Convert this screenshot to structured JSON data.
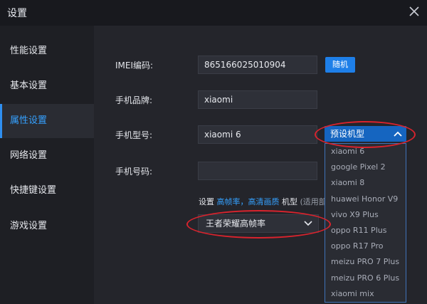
{
  "window": {
    "title": "设置"
  },
  "sidebar": {
    "items": [
      {
        "label": "性能设置"
      },
      {
        "label": "基本设置"
      },
      {
        "label": "属性设置"
      },
      {
        "label": "网络设置"
      },
      {
        "label": "快捷键设置"
      },
      {
        "label": "游戏设置"
      }
    ],
    "active_index": 2
  },
  "form": {
    "imei_label": "IMEI编码:",
    "imei_value": "865166025010904",
    "random_label": "随机",
    "brand_label": "手机品牌:",
    "brand_value": "xiaomi",
    "model_label": "手机型号:",
    "model_value": "xiaomi 6",
    "preset_label": "预设机型",
    "phone_label": "手机号码:",
    "phone_value": ""
  },
  "note": {
    "prefix": "设置",
    "hl1": "高帧率",
    "sep": "，",
    "hl2": "高清画质",
    "suffix": "机型",
    "tail": "(适用部"
  },
  "game_select": {
    "value": "王者荣耀高帧率"
  },
  "preset_models": [
    "xiaomi 6",
    "google Pixel 2",
    "xiaomi 8",
    "huawei Honor V9",
    "vivo X9 Plus",
    "oppo R11 Plus",
    "oppo R17 Pro",
    "meizu PRO 7 Plus",
    "meizu PRO 6 Plus",
    "xiaomi mix"
  ],
  "colors": {
    "accent": "#35a1ff",
    "button": "#1e7fe8",
    "highlight_ring": "#d9232d"
  }
}
